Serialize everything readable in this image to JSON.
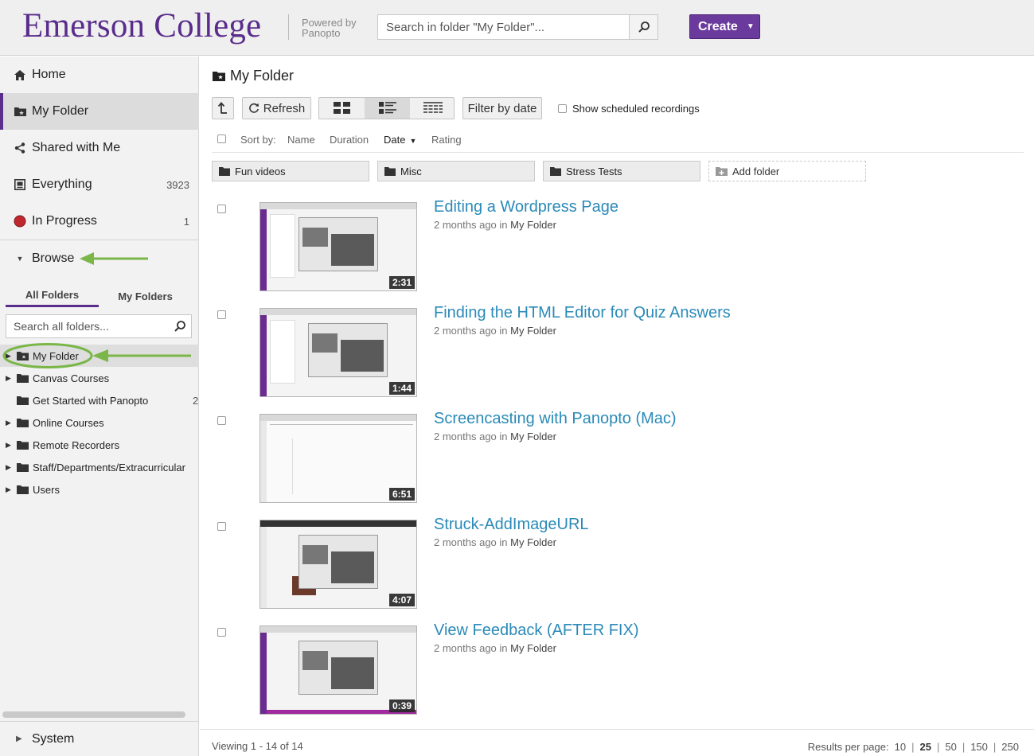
{
  "header": {
    "brand": "Emerson College",
    "powered_by": "Powered by Panopto",
    "search_placeholder": "Search in folder \"My Folder\"...",
    "create_label": "Create"
  },
  "sidebar": {
    "nav": [
      {
        "label": "Home",
        "count": ""
      },
      {
        "label": "My Folder",
        "count": ""
      },
      {
        "label": "Shared with Me",
        "count": ""
      },
      {
        "label": "Everything",
        "count": "3923"
      },
      {
        "label": "In Progress",
        "count": "1"
      }
    ],
    "browse_label": "Browse",
    "tabs": [
      "All Folders",
      "My Folders"
    ],
    "folder_search_placeholder": "Search all folders...",
    "tree": [
      {
        "label": "My Folder",
        "count": "",
        "expandable": true
      },
      {
        "label": "Canvas Courses",
        "count": "",
        "expandable": true
      },
      {
        "label": "Get Started with Panopto",
        "count": "2",
        "expandable": false
      },
      {
        "label": "Online Courses",
        "count": "",
        "expandable": true
      },
      {
        "label": "Remote Recorders",
        "count": "",
        "expandable": true
      },
      {
        "label": "Staff/Departments/Extracurricular",
        "count": "",
        "expandable": true
      },
      {
        "label": "Users",
        "count": "",
        "expandable": true
      }
    ],
    "system_label": "System"
  },
  "main": {
    "title": "My Folder",
    "toolbar": {
      "refresh_label": "Refresh",
      "filter_label": "Filter by date",
      "scheduled_label": "Show scheduled recordings"
    },
    "sort": {
      "prefix": "Sort by:",
      "options": [
        "Name",
        "Duration",
        "Date",
        "Rating"
      ],
      "current": "Date"
    },
    "folders": [
      "Fun videos",
      "Misc",
      "Stress Tests"
    ],
    "add_folder_label": "Add folder",
    "sessions": [
      {
        "title": "Editing a Wordpress Page",
        "age": "2 months ago",
        "in": "in",
        "folder": "My Folder",
        "duration": "2:31",
        "accent": "#6b2c8f"
      },
      {
        "title": "Finding the HTML Editor for Quiz Answers",
        "age": "2 months ago",
        "in": "in",
        "folder": "My Folder",
        "duration": "1:44",
        "accent": "#6b2c8f"
      },
      {
        "title": "Screencasting with Panopto (Mac)",
        "age": "2 months ago",
        "in": "in",
        "folder": "My Folder",
        "duration": "6:51",
        "accent": "#e8e8e8"
      },
      {
        "title": "Struck-AddImageURL",
        "age": "2 months ago",
        "in": "in",
        "folder": "My Folder",
        "duration": "4:07",
        "accent": "#e8e8e8"
      },
      {
        "title": "View Feedback (AFTER FIX)",
        "age": "2 months ago",
        "in": "in",
        "folder": "My Folder",
        "duration": "0:39",
        "accent": "#a02a9e"
      }
    ],
    "footer": {
      "viewing": "Viewing 1 - 14 of 14",
      "results_label": "Results per page:",
      "per_page_options": [
        "10",
        "25",
        "50",
        "150",
        "250"
      ],
      "per_page_current": "25"
    }
  },
  "colors": {
    "brand_purple": "#5a2d8c",
    "create_button": "#6a3a9c",
    "link_blue": "#2a8ab8",
    "annotation_green": "#7ab648",
    "in_progress_red": "#c0262d"
  },
  "icons": {
    "home": "home-icon",
    "my_folder": "folder-star-icon",
    "shared": "share-icon",
    "everything": "library-icon",
    "in_progress": "red-dot-icon",
    "search": "search-icon"
  }
}
